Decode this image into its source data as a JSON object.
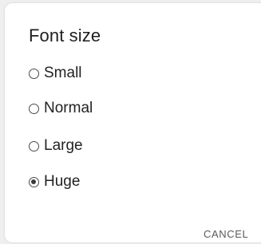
{
  "dialog": {
    "title": "Font size",
    "options": [
      {
        "label": "Small",
        "checked": false
      },
      {
        "label": "Normal",
        "checked": false
      },
      {
        "label": "Large",
        "checked": false
      },
      {
        "label": "Huge",
        "checked": true
      }
    ],
    "cancel_label": "CANCEL"
  }
}
